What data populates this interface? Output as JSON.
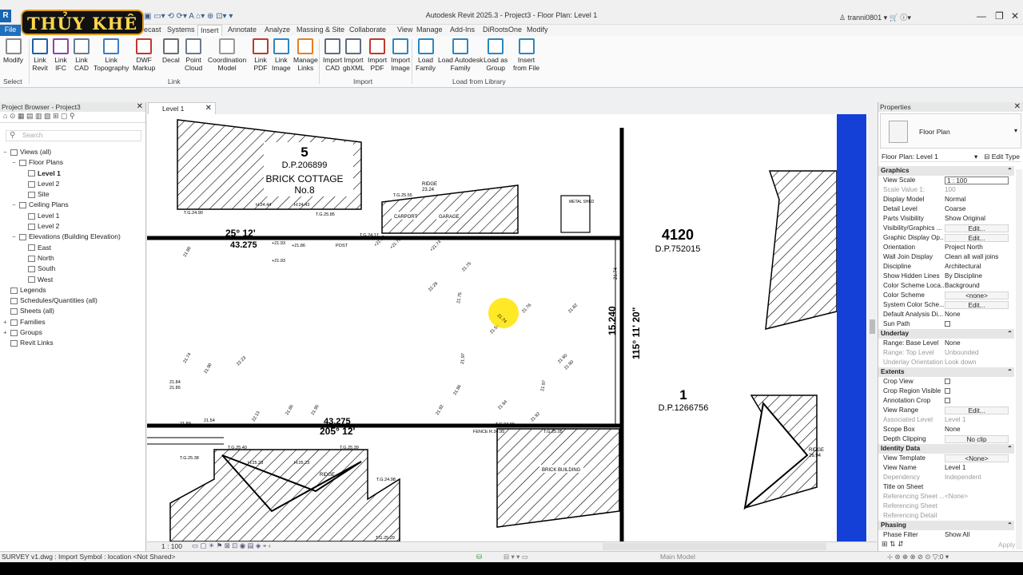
{
  "app": {
    "title": "Autodesk Revit 2025.3 - Project3 - Floor Plan: Level 1",
    "user": "tranni0801",
    "brand": "THỦY KHÊ"
  },
  "menu": {
    "tabs": [
      "File",
      "Precast",
      "Systems",
      "Insert",
      "Annotate",
      "Analyze",
      "Massing & Site",
      "Collaborate",
      "View",
      "Manage",
      "Add-Ins",
      "DiRootsOne",
      "Modify"
    ],
    "active": "Insert"
  },
  "ribbon": {
    "buttons": [
      {
        "label": "Modify"
      },
      {
        "label": "Link\nRevit"
      },
      {
        "label": "Link\nIFC"
      },
      {
        "label": "Link\nCAD"
      },
      {
        "label": "Link\nTopography"
      },
      {
        "label": "DWF\nMarkup"
      },
      {
        "label": "Decal"
      },
      {
        "label": "Point\nCloud"
      },
      {
        "label": "Coordination\nModel"
      },
      {
        "label": "Link\nPDF"
      },
      {
        "label": "Link\nImage"
      },
      {
        "label": "Manage\nLinks"
      },
      {
        "label": "Import\nCAD"
      },
      {
        "label": "Import\ngbXML"
      },
      {
        "label": "Import\nPDF"
      },
      {
        "label": "Import\nImage"
      },
      {
        "label": "Load\nFamily"
      },
      {
        "label": "Load Autodesk\nFamily"
      },
      {
        "label": "Load as\nGroup"
      },
      {
        "label": "Insert\nfrom File"
      }
    ],
    "panels": {
      "select": "Select",
      "link": "Link",
      "import": "Import",
      "load": "Load from Library"
    }
  },
  "browser": {
    "title": "Project Browser - Project3",
    "search_placeholder": "Search",
    "items": [
      {
        "label": "Views (all)",
        "level": 0,
        "tw": "−"
      },
      {
        "label": "Floor Plans",
        "level": 1,
        "tw": "−"
      },
      {
        "label": "Level 1",
        "level": 2,
        "bold": true
      },
      {
        "label": "Level 2",
        "level": 2
      },
      {
        "label": "Site",
        "level": 2
      },
      {
        "label": "Ceiling Plans",
        "level": 1,
        "tw": "−"
      },
      {
        "label": "Level 1",
        "level": 2
      },
      {
        "label": "Level 2",
        "level": 2
      },
      {
        "label": "Elevations (Building Elevation)",
        "level": 1,
        "tw": "−"
      },
      {
        "label": "East",
        "level": 2
      },
      {
        "label": "North",
        "level": 2
      },
      {
        "label": "South",
        "level": 2
      },
      {
        "label": "West",
        "level": 2
      },
      {
        "label": "Legends",
        "level": 0
      },
      {
        "label": "Schedules/Quantities (all)",
        "level": 0
      },
      {
        "label": "Sheets (all)",
        "level": 0
      },
      {
        "label": "Families",
        "level": 0,
        "tw": "+"
      },
      {
        "label": "Groups",
        "level": 0,
        "tw": "+"
      },
      {
        "label": "Revit Links",
        "level": 0
      }
    ]
  },
  "view": {
    "tab": "Level 1",
    "scale": "1 : 100",
    "drawing": {
      "lot5": "5",
      "dp5": "D.P.206899",
      "cottage": "BRICK COTTAGE",
      "no8": "No.8",
      "lot4120": "4120",
      "dp4120": "D.P.752015",
      "lot1": "1",
      "dp1": "D.P.1266756",
      "bearing_top": "25° 12'",
      "dist_top": "43.275",
      "bearing_bot": "205° 12'",
      "dist_bot": "43.275",
      "side_dist": "15.240",
      "side_bearing": "115° 11' 20\"",
      "ridge1": "RIDGE",
      "ridge1v": "23.24",
      "carport": "CARPORT",
      "garage": "GARAGE",
      "metal_shed": "METAL SHED",
      "brick_building": "BRICK BUILDING",
      "fence": "FENCE",
      "post": "POST",
      "ridge2": "RIDGE",
      "ridge2v": "26.94",
      "ridge3": "RIDGE"
    }
  },
  "properties": {
    "title": "Properties",
    "type": "Floor Plan",
    "view_selector": "Floor Plan: Level 1",
    "edit_type": "Edit Type",
    "rows": [
      {
        "grp": "Graphics"
      },
      {
        "k": "View Scale",
        "v": "1 : 100",
        "kind": "box"
      },
      {
        "k": "Scale Value   1:",
        "v": "100",
        "dis": true
      },
      {
        "k": "Display Model",
        "v": "Normal"
      },
      {
        "k": "Detail Level",
        "v": "Coarse"
      },
      {
        "k": "Parts Visibility",
        "v": "Show Original"
      },
      {
        "k": "Visibility/Graphics ...",
        "v": "Edit...",
        "kind": "btn"
      },
      {
        "k": "Graphic Display Op...",
        "v": "Edit...",
        "kind": "btn"
      },
      {
        "k": "Orientation",
        "v": "Project North"
      },
      {
        "k": "Wall Join Display",
        "v": "Clean all wall joins"
      },
      {
        "k": "Discipline",
        "v": "Architectural"
      },
      {
        "k": "Show Hidden Lines",
        "v": "By Discipline"
      },
      {
        "k": "Color Scheme Loca...",
        "v": "Background"
      },
      {
        "k": "Color Scheme",
        "v": "<none>",
        "kind": "btn"
      },
      {
        "k": "System Color Sche...",
        "v": "Edit...",
        "kind": "btn"
      },
      {
        "k": "Default Analysis Di...",
        "v": "None"
      },
      {
        "k": "Sun Path",
        "v": "",
        "kind": "cb"
      },
      {
        "grp": "Underlay"
      },
      {
        "k": "Range: Base Level",
        "v": "None"
      },
      {
        "k": "Range: Top Level",
        "v": "Unbounded",
        "dis": true
      },
      {
        "k": "Underlay Orientation",
        "v": "Look down",
        "dis": true
      },
      {
        "grp": "Extents"
      },
      {
        "k": "Crop View",
        "v": "",
        "kind": "cb"
      },
      {
        "k": "Crop Region Visible",
        "v": "",
        "kind": "cb"
      },
      {
        "k": "Annotation Crop",
        "v": "",
        "kind": "cb"
      },
      {
        "k": "View Range",
        "v": "Edit...",
        "kind": "btn"
      },
      {
        "k": "Associated Level",
        "v": "Level 1",
        "dis": true
      },
      {
        "k": "Scope Box",
        "v": "None"
      },
      {
        "k": "Depth Clipping",
        "v": "No clip",
        "kind": "btn"
      },
      {
        "grp": "Identity Data"
      },
      {
        "k": "View Template",
        "v": "<None>",
        "kind": "btn"
      },
      {
        "k": "View Name",
        "v": "Level 1"
      },
      {
        "k": "Dependency",
        "v": "Independent",
        "dis": true
      },
      {
        "k": "Title on Sheet",
        "v": ""
      },
      {
        "k": "Referencing Sheet ...",
        "v": "<None>",
        "dis": true
      },
      {
        "k": "Referencing Sheet",
        "v": "",
        "dis": true
      },
      {
        "k": "Referencing Detail",
        "v": "",
        "dis": true
      },
      {
        "grp": "Phasing"
      },
      {
        "k": "Phase Filter",
        "v": "Show All"
      }
    ],
    "apply": "Apply"
  },
  "status": {
    "text": "SURVEY v1.dwg : Import Symbol : location <Not Shared>",
    "model": "Main Model"
  }
}
